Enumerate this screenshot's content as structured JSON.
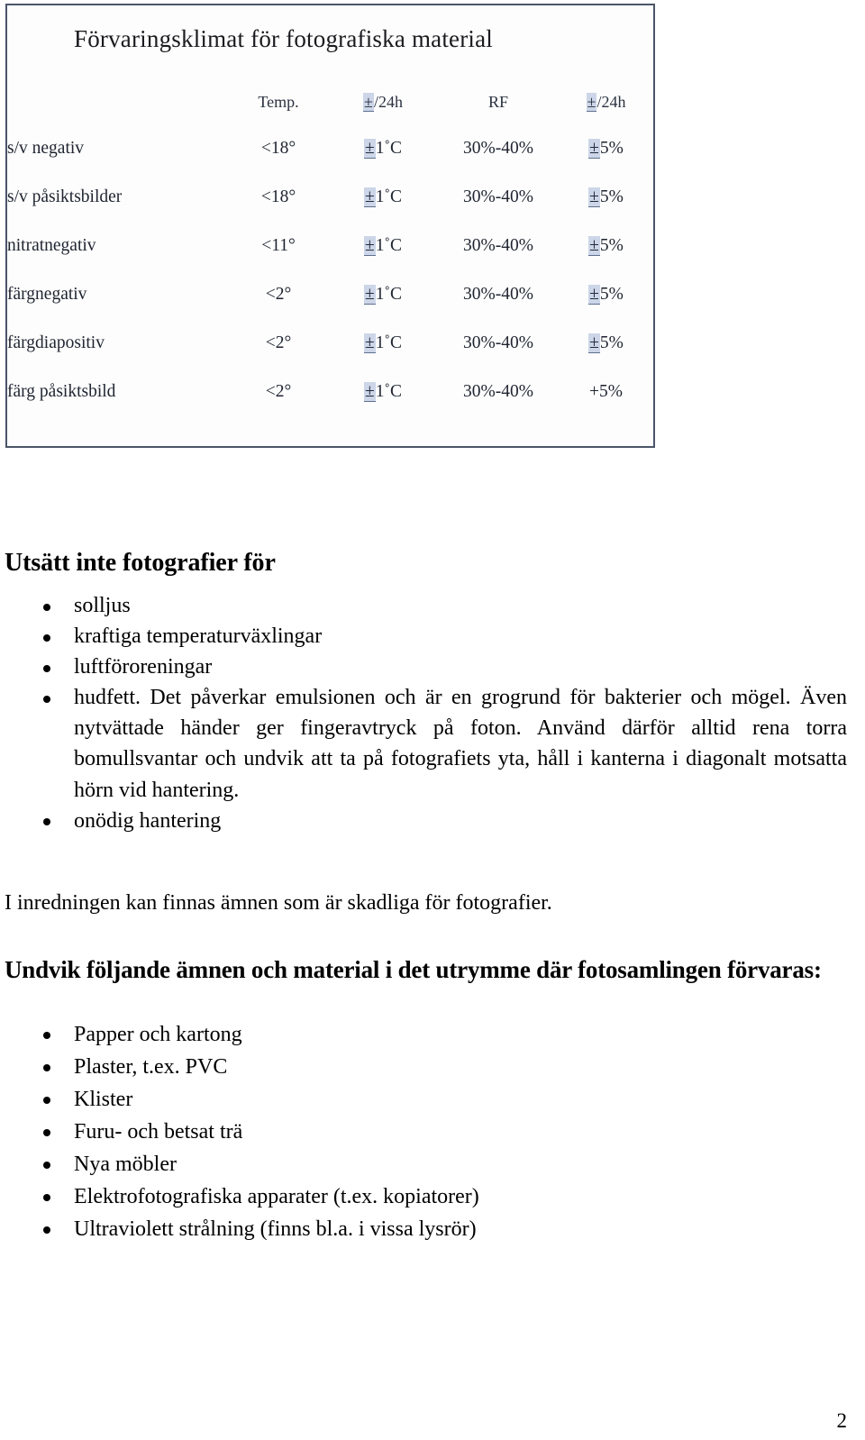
{
  "figure": {
    "title": "Förvaringsklimat för fotografiska material",
    "table": {
      "columns": [
        "",
        "Temp.",
        "±/24h",
        "RF",
        "±/24h"
      ],
      "rows": [
        {
          "material": "s/v negativ",
          "temp": "<18°",
          "temp_dev_pm": "±",
          "temp_dev_rest": "1˚C",
          "rf": "30%-40%",
          "rf_dev_pm": "±",
          "rf_dev_rest": "5%",
          "rf_dev_highlighted": true
        },
        {
          "material": "s/v påsiktsbilder",
          "temp": "<18°",
          "temp_dev_pm": "±",
          "temp_dev_rest": "1˚C",
          "rf": "30%-40%",
          "rf_dev_pm": "±",
          "rf_dev_rest": "5%",
          "rf_dev_highlighted": true
        },
        {
          "material": "nitratnegativ",
          "temp": "<11°",
          "temp_dev_pm": "±",
          "temp_dev_rest": "1˚C",
          "rf": "30%-40%",
          "rf_dev_pm": "±",
          "rf_dev_rest": "5%",
          "rf_dev_highlighted": true
        },
        {
          "material": "färgnegativ",
          "temp": "<2°",
          "temp_dev_pm": "±",
          "temp_dev_rest": "1˚C",
          "rf": "30%-40%",
          "rf_dev_pm": "±",
          "rf_dev_rest": "5%",
          "rf_dev_highlighted": true
        },
        {
          "material": "färgdiapositiv",
          "temp": "<2°",
          "temp_dev_pm": "±",
          "temp_dev_rest": "1˚C",
          "rf": "30%-40%",
          "rf_dev_pm": "±",
          "rf_dev_rest": "5%",
          "rf_dev_highlighted": true
        },
        {
          "material": "färg påsiktsbild",
          "temp": "<2°",
          "temp_dev_pm": "±",
          "temp_dev_rest": "1˚C",
          "rf": "30%-40%",
          "rf_dev_pm": "+",
          "rf_dev_rest": "5%",
          "rf_dev_highlighted": false
        }
      ]
    }
  },
  "body": {
    "heading": "Utsätt inte fotografier för",
    "bullets_exposure": [
      "solljus",
      "kraftiga temperaturväxlingar",
      "luftföroreningar"
    ],
    "bullet_skin": "hudfett. Det påverkar emulsionen och är en grogrund för bakterier och mögel. Även nytvättade händer ger fingeravtryck på foton. Använd därför alltid rena torra bomullsvantar och undvik att ta på fotografiets yta, håll i kanterna i diagonalt motsatta hörn vid hantering.",
    "bullet_handling": "onödig hantering",
    "interior_note": "I inredningen kan finnas ämnen som är skadliga för fotografier.",
    "avoid_heading": "Undvik följande ämnen och material i det utrymme där fotosamlingen förvaras:",
    "bullets_avoid": [
      "Papper och kartong",
      "Plaster, t.ex. PVC",
      "Klister",
      "Furu- och betsat trä",
      "Nya möbler",
      "Elektrofotografiska apparater (t.ex. kopiatorer)",
      "Ultraviolett strålning (finns bl.a. i vissa lysrör)"
    ]
  },
  "footer": {
    "page_number": "2"
  }
}
